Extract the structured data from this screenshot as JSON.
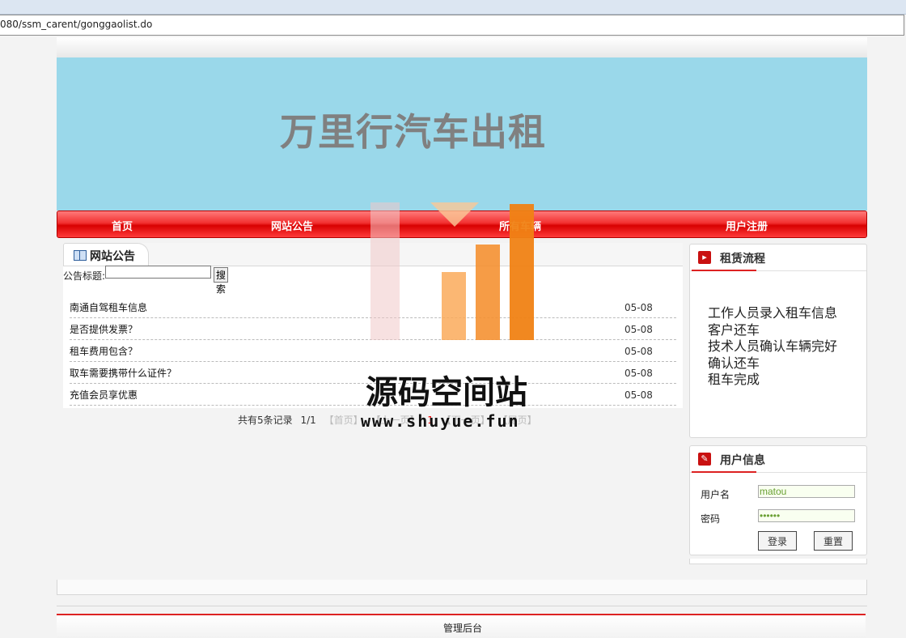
{
  "browser": {
    "url": "080/ssm_carent/gonggaolist.do"
  },
  "banner": {
    "title": "万里行汽车出租"
  },
  "nav": [
    {
      "label": "首页"
    },
    {
      "label": "网站公告"
    },
    {
      "label": "所有车辆"
    },
    {
      "label": "用户注册"
    }
  ],
  "notices": {
    "tab_title": "网站公告",
    "search_label": "公告标题:",
    "search_value": "",
    "search_button": "搜索",
    "items": [
      {
        "title": "南通自驾租车信息",
        "date": "05-08"
      },
      {
        "title": "是否提供发票？",
        "date": "05-08"
      },
      {
        "title": "租车费用包含？",
        "date": "05-08"
      },
      {
        "title": "取车需要携带什么证件？",
        "date": "05-08"
      },
      {
        "title": "充值会员享优惠",
        "date": "05-08"
      }
    ],
    "pager": {
      "total": "共有5条记录",
      "pages": "1/1",
      "first": "【首页】",
      "prev": "【上一页】",
      "current": "1",
      "next": "【下一页】",
      "last": "【尾页】"
    }
  },
  "process": {
    "title": "租赁流程",
    "steps": [
      "工作人员录入租车信息",
      "客户还车",
      "技术人员确认车辆完好",
      "确认还车",
      "租车完成"
    ]
  },
  "userinfo": {
    "title": "用户信息",
    "username_label": "用户名",
    "username_value": "matou",
    "password_label": "密码",
    "password_value": "••••••",
    "login_button": "登录",
    "reset_button": "重置"
  },
  "footer": {
    "admin_link": "管理后台"
  },
  "watermark": {
    "name": "源码空间站",
    "site": "www.shuyue.fun"
  },
  "colors": {
    "banner_bg": "#9ad8ea",
    "nav_red": "#e81010",
    "accent": "#c91010"
  }
}
